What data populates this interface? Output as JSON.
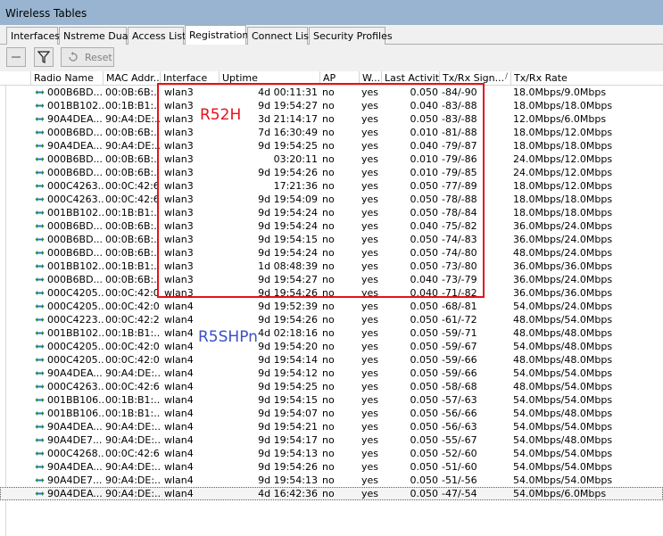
{
  "window": {
    "title": "Wireless Tables"
  },
  "tabs": [
    {
      "label": "Interfaces",
      "active": false
    },
    {
      "label": "Nstreme Dual",
      "active": false
    },
    {
      "label": "Access List",
      "active": false
    },
    {
      "label": "Registration",
      "active": true
    },
    {
      "label": "Connect List",
      "active": false
    },
    {
      "label": "Security Profiles",
      "active": false
    }
  ],
  "toolbar": {
    "remove_icon": "minus-icon",
    "filter_icon": "filter-icon",
    "reset_label": "Reset"
  },
  "columns": [
    "Radio Name",
    "MAC Addr...",
    "Interface",
    "Uptime",
    "AP",
    "W...",
    "Last Activit...",
    "Tx/Rx Sign...",
    "Tx/Rx Rate"
  ],
  "sort_indicator": "/",
  "rows": [
    [
      "000B6BD...",
      "00:0B:6B:...",
      "wlan3",
      "4d 00:11:31",
      "no",
      "yes",
      "0.050",
      "-84/-90",
      "18.0Mbps/9.0Mbps"
    ],
    [
      "001BB102...",
      "00:1B:B1:...",
      "wlan3",
      "9d 19:54:27",
      "no",
      "yes",
      "0.040",
      "-83/-88",
      "18.0Mbps/18.0Mbps"
    ],
    [
      "90A4DEA...",
      "90:A4:DE:...",
      "wlan3",
      "3d 21:14:17",
      "no",
      "yes",
      "0.050",
      "-83/-88",
      "12.0Mbps/6.0Mbps"
    ],
    [
      "000B6BD...",
      "00:0B:6B:...",
      "wlan3",
      "7d 16:30:49",
      "no",
      "yes",
      "0.010",
      "-81/-88",
      "18.0Mbps/12.0Mbps"
    ],
    [
      "90A4DEA...",
      "90:A4:DE:...",
      "wlan3",
      "9d 19:54:25",
      "no",
      "yes",
      "0.040",
      "-79/-87",
      "18.0Mbps/18.0Mbps"
    ],
    [
      "000B6BD...",
      "00:0B:6B:...",
      "wlan3",
      "03:20:11",
      "no",
      "yes",
      "0.010",
      "-79/-86",
      "24.0Mbps/12.0Mbps"
    ],
    [
      "000B6BD...",
      "00:0B:6B:...",
      "wlan3",
      "9d 19:54:26",
      "no",
      "yes",
      "0.010",
      "-79/-85",
      "24.0Mbps/12.0Mbps"
    ],
    [
      "000C4263...",
      "00:0C:42:6...",
      "wlan3",
      "17:21:36",
      "no",
      "yes",
      "0.050",
      "-77/-89",
      "18.0Mbps/12.0Mbps"
    ],
    [
      "000C4263...",
      "00:0C:42:6...",
      "wlan3",
      "9d 19:54:09",
      "no",
      "yes",
      "0.050",
      "-78/-88",
      "18.0Mbps/18.0Mbps"
    ],
    [
      "001BB102...",
      "00:1B:B1:...",
      "wlan3",
      "9d 19:54:24",
      "no",
      "yes",
      "0.050",
      "-78/-84",
      "18.0Mbps/18.0Mbps"
    ],
    [
      "000B6BD...",
      "00:0B:6B:...",
      "wlan3",
      "9d 19:54:24",
      "no",
      "yes",
      "0.040",
      "-75/-82",
      "36.0Mbps/24.0Mbps"
    ],
    [
      "000B6BD...",
      "00:0B:6B:...",
      "wlan3",
      "9d 19:54:15",
      "no",
      "yes",
      "0.050",
      "-74/-83",
      "36.0Mbps/24.0Mbps"
    ],
    [
      "000B6BD...",
      "00:0B:6B:...",
      "wlan3",
      "9d 19:54:24",
      "no",
      "yes",
      "0.050",
      "-74/-80",
      "48.0Mbps/24.0Mbps"
    ],
    [
      "001BB102...",
      "00:1B:B1:...",
      "wlan3",
      "1d 08:48:39",
      "no",
      "yes",
      "0.050",
      "-73/-80",
      "36.0Mbps/36.0Mbps"
    ],
    [
      "000B6BD...",
      "00:0B:6B:...",
      "wlan3",
      "9d 19:54:27",
      "no",
      "yes",
      "0.040",
      "-73/-79",
      "36.0Mbps/24.0Mbps"
    ],
    [
      "000C4205...",
      "00:0C:42:0...",
      "wlan3",
      "9d 19:54:26",
      "no",
      "yes",
      "0.040",
      "-71/-82",
      "36.0Mbps/36.0Mbps"
    ],
    [
      "000C4205...",
      "00:0C:42:0...",
      "wlan4",
      "9d 19:52:39",
      "no",
      "yes",
      "0.050",
      "-68/-81",
      "54.0Mbps/24.0Mbps"
    ],
    [
      "000C4223...",
      "00:0C:42:2...",
      "wlan4",
      "9d 19:54:26",
      "no",
      "yes",
      "0.050",
      "-61/-72",
      "48.0Mbps/54.0Mbps"
    ],
    [
      "001BB102...",
      "00:1B:B1:...",
      "wlan4",
      "4d 02:18:16",
      "no",
      "yes",
      "0.050",
      "-59/-71",
      "48.0Mbps/48.0Mbps"
    ],
    [
      "000C4205...",
      "00:0C:42:0...",
      "wlan4",
      "9d 19:54:20",
      "no",
      "yes",
      "0.050",
      "-59/-67",
      "54.0Mbps/48.0Mbps"
    ],
    [
      "000C4205...",
      "00:0C:42:0...",
      "wlan4",
      "9d 19:54:14",
      "no",
      "yes",
      "0.050",
      "-59/-66",
      "48.0Mbps/48.0Mbps"
    ],
    [
      "90A4DEA...",
      "90:A4:DE:...",
      "wlan4",
      "9d 19:54:12",
      "no",
      "yes",
      "0.050",
      "-59/-66",
      "54.0Mbps/54.0Mbps"
    ],
    [
      "000C4263...",
      "00:0C:42:6...",
      "wlan4",
      "9d 19:54:25",
      "no",
      "yes",
      "0.050",
      "-58/-68",
      "48.0Mbps/54.0Mbps"
    ],
    [
      "001BB106...",
      "00:1B:B1:...",
      "wlan4",
      "9d 19:54:15",
      "no",
      "yes",
      "0.050",
      "-57/-63",
      "54.0Mbps/54.0Mbps"
    ],
    [
      "001BB106...",
      "00:1B:B1:...",
      "wlan4",
      "9d 19:54:07",
      "no",
      "yes",
      "0.050",
      "-56/-66",
      "54.0Mbps/48.0Mbps"
    ],
    [
      "90A4DEA...",
      "90:A4:DE:...",
      "wlan4",
      "9d 19:54:21",
      "no",
      "yes",
      "0.050",
      "-56/-63",
      "54.0Mbps/54.0Mbps"
    ],
    [
      "90A4DE7...",
      "90:A4:DE:...",
      "wlan4",
      "9d 19:54:17",
      "no",
      "yes",
      "0.050",
      "-55/-67",
      "54.0Mbps/48.0Mbps"
    ],
    [
      "000C4268...",
      "00:0C:42:6...",
      "wlan4",
      "9d 19:54:13",
      "no",
      "yes",
      "0.050",
      "-52/-60",
      "54.0Mbps/54.0Mbps"
    ],
    [
      "90A4DEA...",
      "90:A4:DE:...",
      "wlan4",
      "9d 19:54:26",
      "no",
      "yes",
      "0.050",
      "-51/-60",
      "54.0Mbps/54.0Mbps"
    ],
    [
      "90A4DE7...",
      "90:A4:DE:...",
      "wlan4",
      "9d 19:54:13",
      "no",
      "yes",
      "0.050",
      "-51/-56",
      "54.0Mbps/54.0Mbps"
    ],
    [
      "90A4DEA...",
      "90:A4:DE:...",
      "wlan4",
      "4d 16:42:36",
      "no",
      "yes",
      "0.050",
      "-47/-54",
      "54.0Mbps/6.0Mbps"
    ]
  ],
  "selected_row_index": 30,
  "annotations": [
    {
      "text": "R52H",
      "color": "#e8101a"
    },
    {
      "text": "R5SHPn",
      "color": "#3a4fc4"
    }
  ],
  "annotation_box_color": "#e8101a"
}
